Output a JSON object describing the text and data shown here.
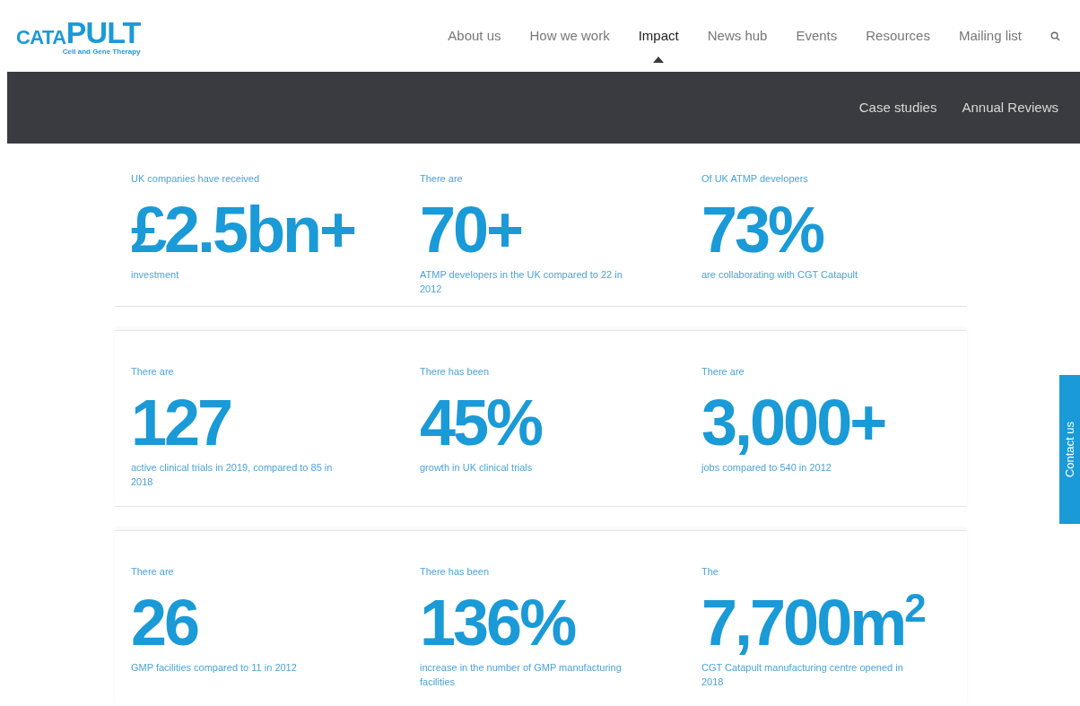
{
  "logo": {
    "wordmark_small": "CATA",
    "wordmark_large": "PULT",
    "tagline": "Cell and Gene Therapy"
  },
  "nav": [
    {
      "label": "About us",
      "selected": false
    },
    {
      "label": "How we work",
      "selected": false
    },
    {
      "label": "Impact",
      "selected": true
    },
    {
      "label": "News hub",
      "selected": false
    },
    {
      "label": "Events",
      "selected": false
    },
    {
      "label": "Resources",
      "selected": false
    },
    {
      "label": "Mailing list",
      "selected": false
    }
  ],
  "subnav": [
    "Case studies",
    "Annual Reviews"
  ],
  "stat_rows": [
    [
      {
        "intro": "UK companies have received",
        "figure": "£2.5bn+",
        "description": "investment"
      },
      {
        "intro": "There are",
        "figure": "70+",
        "description": "ATMP developers in the UK compared to 22 in 2012"
      },
      {
        "intro": "Of UK ATMP developers",
        "figure": "73%",
        "description": "are collaborating with CGT Catapult"
      }
    ],
    [
      {
        "intro": "There are",
        "figure": "127",
        "description": "active clinical trials in 2019, compared to 85 in 2018"
      },
      {
        "intro": "There has been",
        "figure": "45%",
        "description": "growth in UK clinical trials"
      },
      {
        "intro": "There are",
        "figure": "3,000+",
        "description": "jobs compared to 540 in 2012"
      }
    ],
    [
      {
        "intro": "There are",
        "figure": "26",
        "description": "GMP facilities compared to 11 in 2012"
      },
      {
        "intro": "There has been",
        "figure": "136%",
        "description": "increase in the number of GMP manufacturing facilities"
      },
      {
        "intro": "The",
        "figure": "7,700m$^{2}$",
        "description": "CGT Catapult manufacturing centre opened in 2018"
      }
    ]
  ],
  "contact_tab": "Contact us"
}
